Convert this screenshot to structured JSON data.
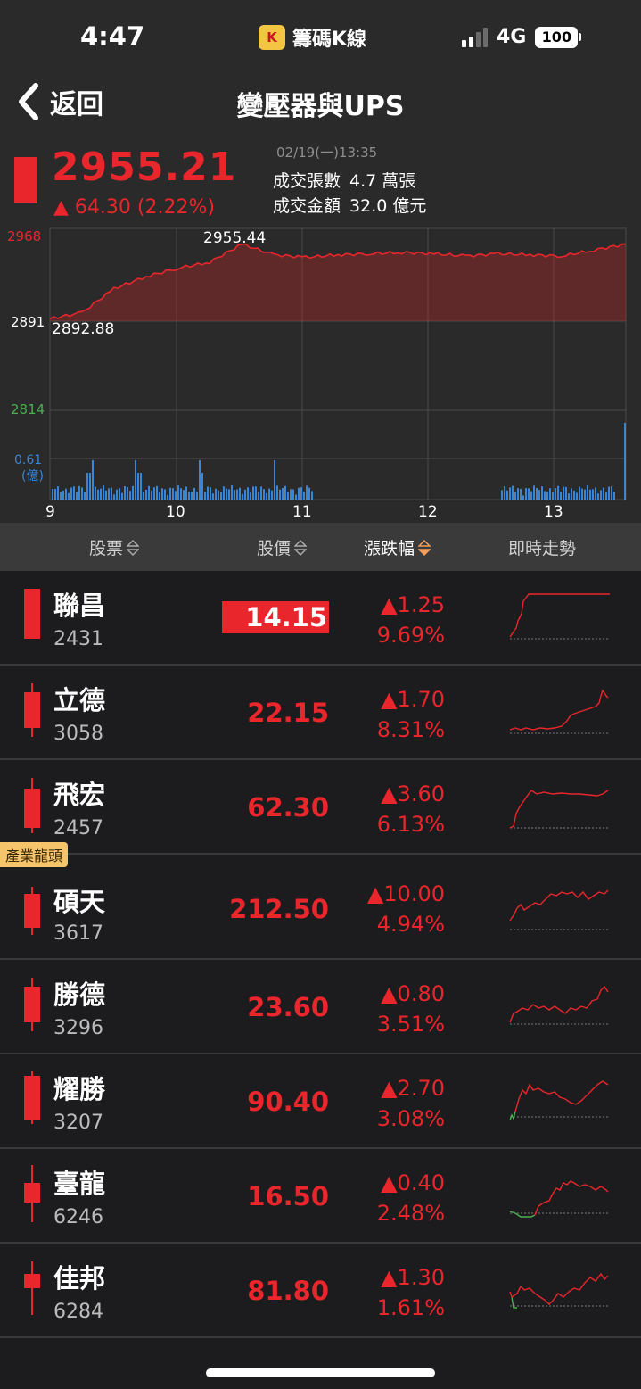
{
  "status": {
    "time": "4:47",
    "app_icon_label": "K",
    "app_name": "籌碼K線",
    "network": "4G",
    "battery": "100"
  },
  "nav": {
    "back_label": "返回",
    "title": "變壓器與UPS"
  },
  "quote": {
    "price": "2955.21",
    "change": "▲ 64.30 (2.22%)",
    "time": "02/19(一)13:35",
    "vol_label": "成交張數",
    "vol_value": "4.7 萬張",
    "amt_label": "成交金額",
    "amt_value": "32.0 億元",
    "up_color": "#e8262c"
  },
  "chart": {
    "y_labels": {
      "high": "2968",
      "ref": "2891",
      "low": "2814"
    },
    "annotations": {
      "max": "2955.44",
      "min": "2892.88"
    },
    "vol_label": "0.61",
    "vol_unit": "(億)",
    "x_ticks": [
      "9",
      "10",
      "11",
      "12",
      "13"
    ]
  },
  "chart_data": {
    "type": "line",
    "x_label_ticks": [
      "9",
      "10",
      "11",
      "12",
      "13"
    ],
    "ylim": [
      2814,
      2968
    ],
    "reference": 2891,
    "max": 2955.44,
    "min": 2892.88,
    "last": 2955.21,
    "x": [
      9.0,
      9.25,
      9.5,
      9.75,
      10.0,
      10.25,
      10.5,
      10.75,
      11.0,
      11.25,
      11.5,
      11.75,
      12.0,
      12.25,
      12.5,
      12.75,
      13.0,
      13.25,
      13.5
    ],
    "values": [
      2893,
      2898,
      2918,
      2928,
      2935,
      2940,
      2955,
      2946,
      2944,
      2946,
      2947,
      2948,
      2947,
      2945,
      2947,
      2946,
      2945,
      2950,
      2955
    ]
  },
  "table": {
    "headers": {
      "stock": "股票",
      "price": "股價",
      "change": "漲跌幅",
      "trend": "即時走勢"
    },
    "rows": [
      {
        "name": "聯昌",
        "code": "2431",
        "price": "14.15",
        "change": "▲1.25",
        "pct": "9.69%",
        "highlight": true,
        "tag": ""
      },
      {
        "name": "立德",
        "code": "3058",
        "price": "22.15",
        "change": "▲1.70",
        "pct": "8.31%",
        "highlight": false,
        "tag": ""
      },
      {
        "name": "飛宏",
        "code": "2457",
        "price": "62.30",
        "change": "▲3.60",
        "pct": "6.13%",
        "highlight": false,
        "tag": ""
      },
      {
        "name": "碩天",
        "code": "3617",
        "price": "212.50",
        "change": "▲10.00",
        "pct": "4.94%",
        "highlight": false,
        "tag": "產業龍頭"
      },
      {
        "name": "勝德",
        "code": "3296",
        "price": "23.60",
        "change": "▲0.80",
        "pct": "3.51%",
        "highlight": false,
        "tag": ""
      },
      {
        "name": "耀勝",
        "code": "3207",
        "price": "90.40",
        "change": "▲2.70",
        "pct": "3.08%",
        "highlight": false,
        "tag": ""
      },
      {
        "name": "臺龍",
        "code": "6246",
        "price": "16.50",
        "change": "▲0.40",
        "pct": "2.48%",
        "highlight": false,
        "tag": ""
      },
      {
        "name": "佳邦",
        "code": "6284",
        "price": "81.80",
        "change": "▲1.30",
        "pct": "1.61%",
        "highlight": false,
        "tag": ""
      }
    ]
  }
}
